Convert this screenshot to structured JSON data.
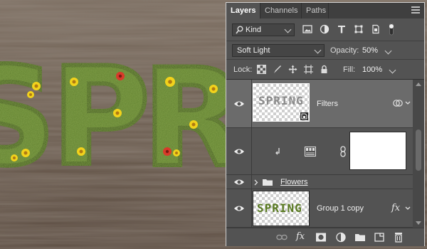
{
  "canvas": {
    "art_letters": [
      "S",
      "P",
      "R"
    ]
  },
  "tabs": [
    {
      "label": "Layers",
      "active": true
    },
    {
      "label": "Channels",
      "active": false
    },
    {
      "label": "Paths",
      "active": false
    }
  ],
  "filter": {
    "kind_label": "Kind",
    "icons": [
      "image-filter-icon",
      "adjustment-filter-icon",
      "type-filter-icon",
      "shape-filter-icon",
      "smart-object-filter-icon",
      "filter-toggle-icon"
    ]
  },
  "blend": {
    "mode": "Soft Light",
    "opacity_label": "Opacity:",
    "opacity_value": "50%"
  },
  "lock": {
    "label": "Lock:",
    "icons": [
      "lock-transparent-pixels-icon",
      "lock-image-pixels-icon",
      "lock-position-icon",
      "lock-artboard-icon",
      "lock-all-icon"
    ],
    "fill_label": "Fill:",
    "fill_value": "100%"
  },
  "layers": [
    {
      "name": "Filters",
      "type": "smart-object",
      "thumb_text": "SPRING",
      "badges": [
        "smart-filter-icon",
        "expand-chevron-icon"
      ]
    },
    {
      "name": "",
      "type": "adjustment",
      "thumb_text": "",
      "badges": [
        "clip-arrow-icon",
        "adjustment-icon",
        "link-icon"
      ]
    },
    {
      "name": "Flowers",
      "type": "group",
      "thumb_text": ""
    },
    {
      "name": "Group 1 copy",
      "type": "group-merged",
      "thumb_text": "SPRING",
      "badges": [
        "fx-icon",
        "expand-chevron-icon"
      ]
    }
  ],
  "footer_icons": [
    "link-layers-icon",
    "fx-icon",
    "add-mask-icon",
    "adjustment-layer-icon",
    "new-group-icon",
    "new-layer-icon",
    "delete-icon"
  ],
  "colors": {
    "panel_bg": "#535353",
    "selected_row": "#6b6b6b",
    "grass_green": "#5f7f2e",
    "wood": "#6e5f52"
  }
}
